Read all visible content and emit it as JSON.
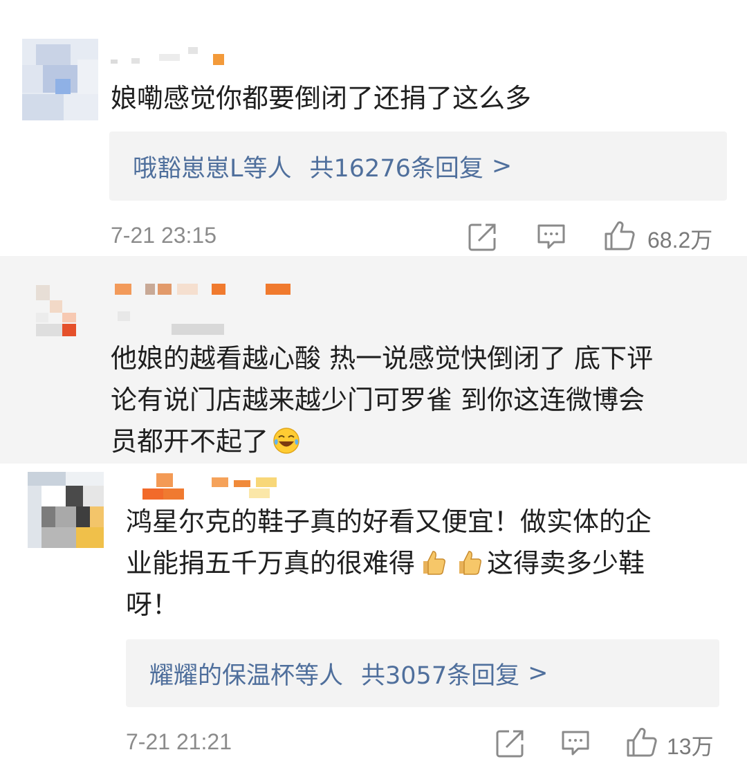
{
  "comments": [
    {
      "text": "娘嘞感觉你都要倒闭了还捐了这么多",
      "replies_who": "哦豁崽崽L等人",
      "replies_count": "共16276条回复",
      "replies_arrow": ">",
      "time": "7-21 23:15",
      "likes": "68.2万"
    },
    {
      "text_line1": "他娘的越看越心酸 热一说感觉快倒闭了 底下评",
      "text_line2": "论有说门店越来越少门可罗雀 到你这连微博会",
      "text_line3": "员都开不起了"
    },
    {
      "text_line1": "鸿星尔克的鞋子真的好看又便宜！做实体的企",
      "text_line2a": "业能捐五千万真的很难得",
      "text_line2b": "这得卖多少鞋",
      "text_line3": "呀！",
      "replies_who": "耀耀的保温杯等人",
      "replies_count": "共3057条回复",
      "replies_arrow": ">",
      "time": "7-21 21:21",
      "likes": "13万"
    }
  ],
  "icons": {
    "share": "share-icon",
    "comment": "comment-icon",
    "like": "like-icon",
    "laugh_cry": "laugh-cry-emoji-icon",
    "thumbs_up": "thumbs-up-emoji-icon"
  },
  "colors": {
    "link": "#4f6f9c",
    "time": "#8b8b8b",
    "highlight_bg": "#f4f4f4"
  }
}
